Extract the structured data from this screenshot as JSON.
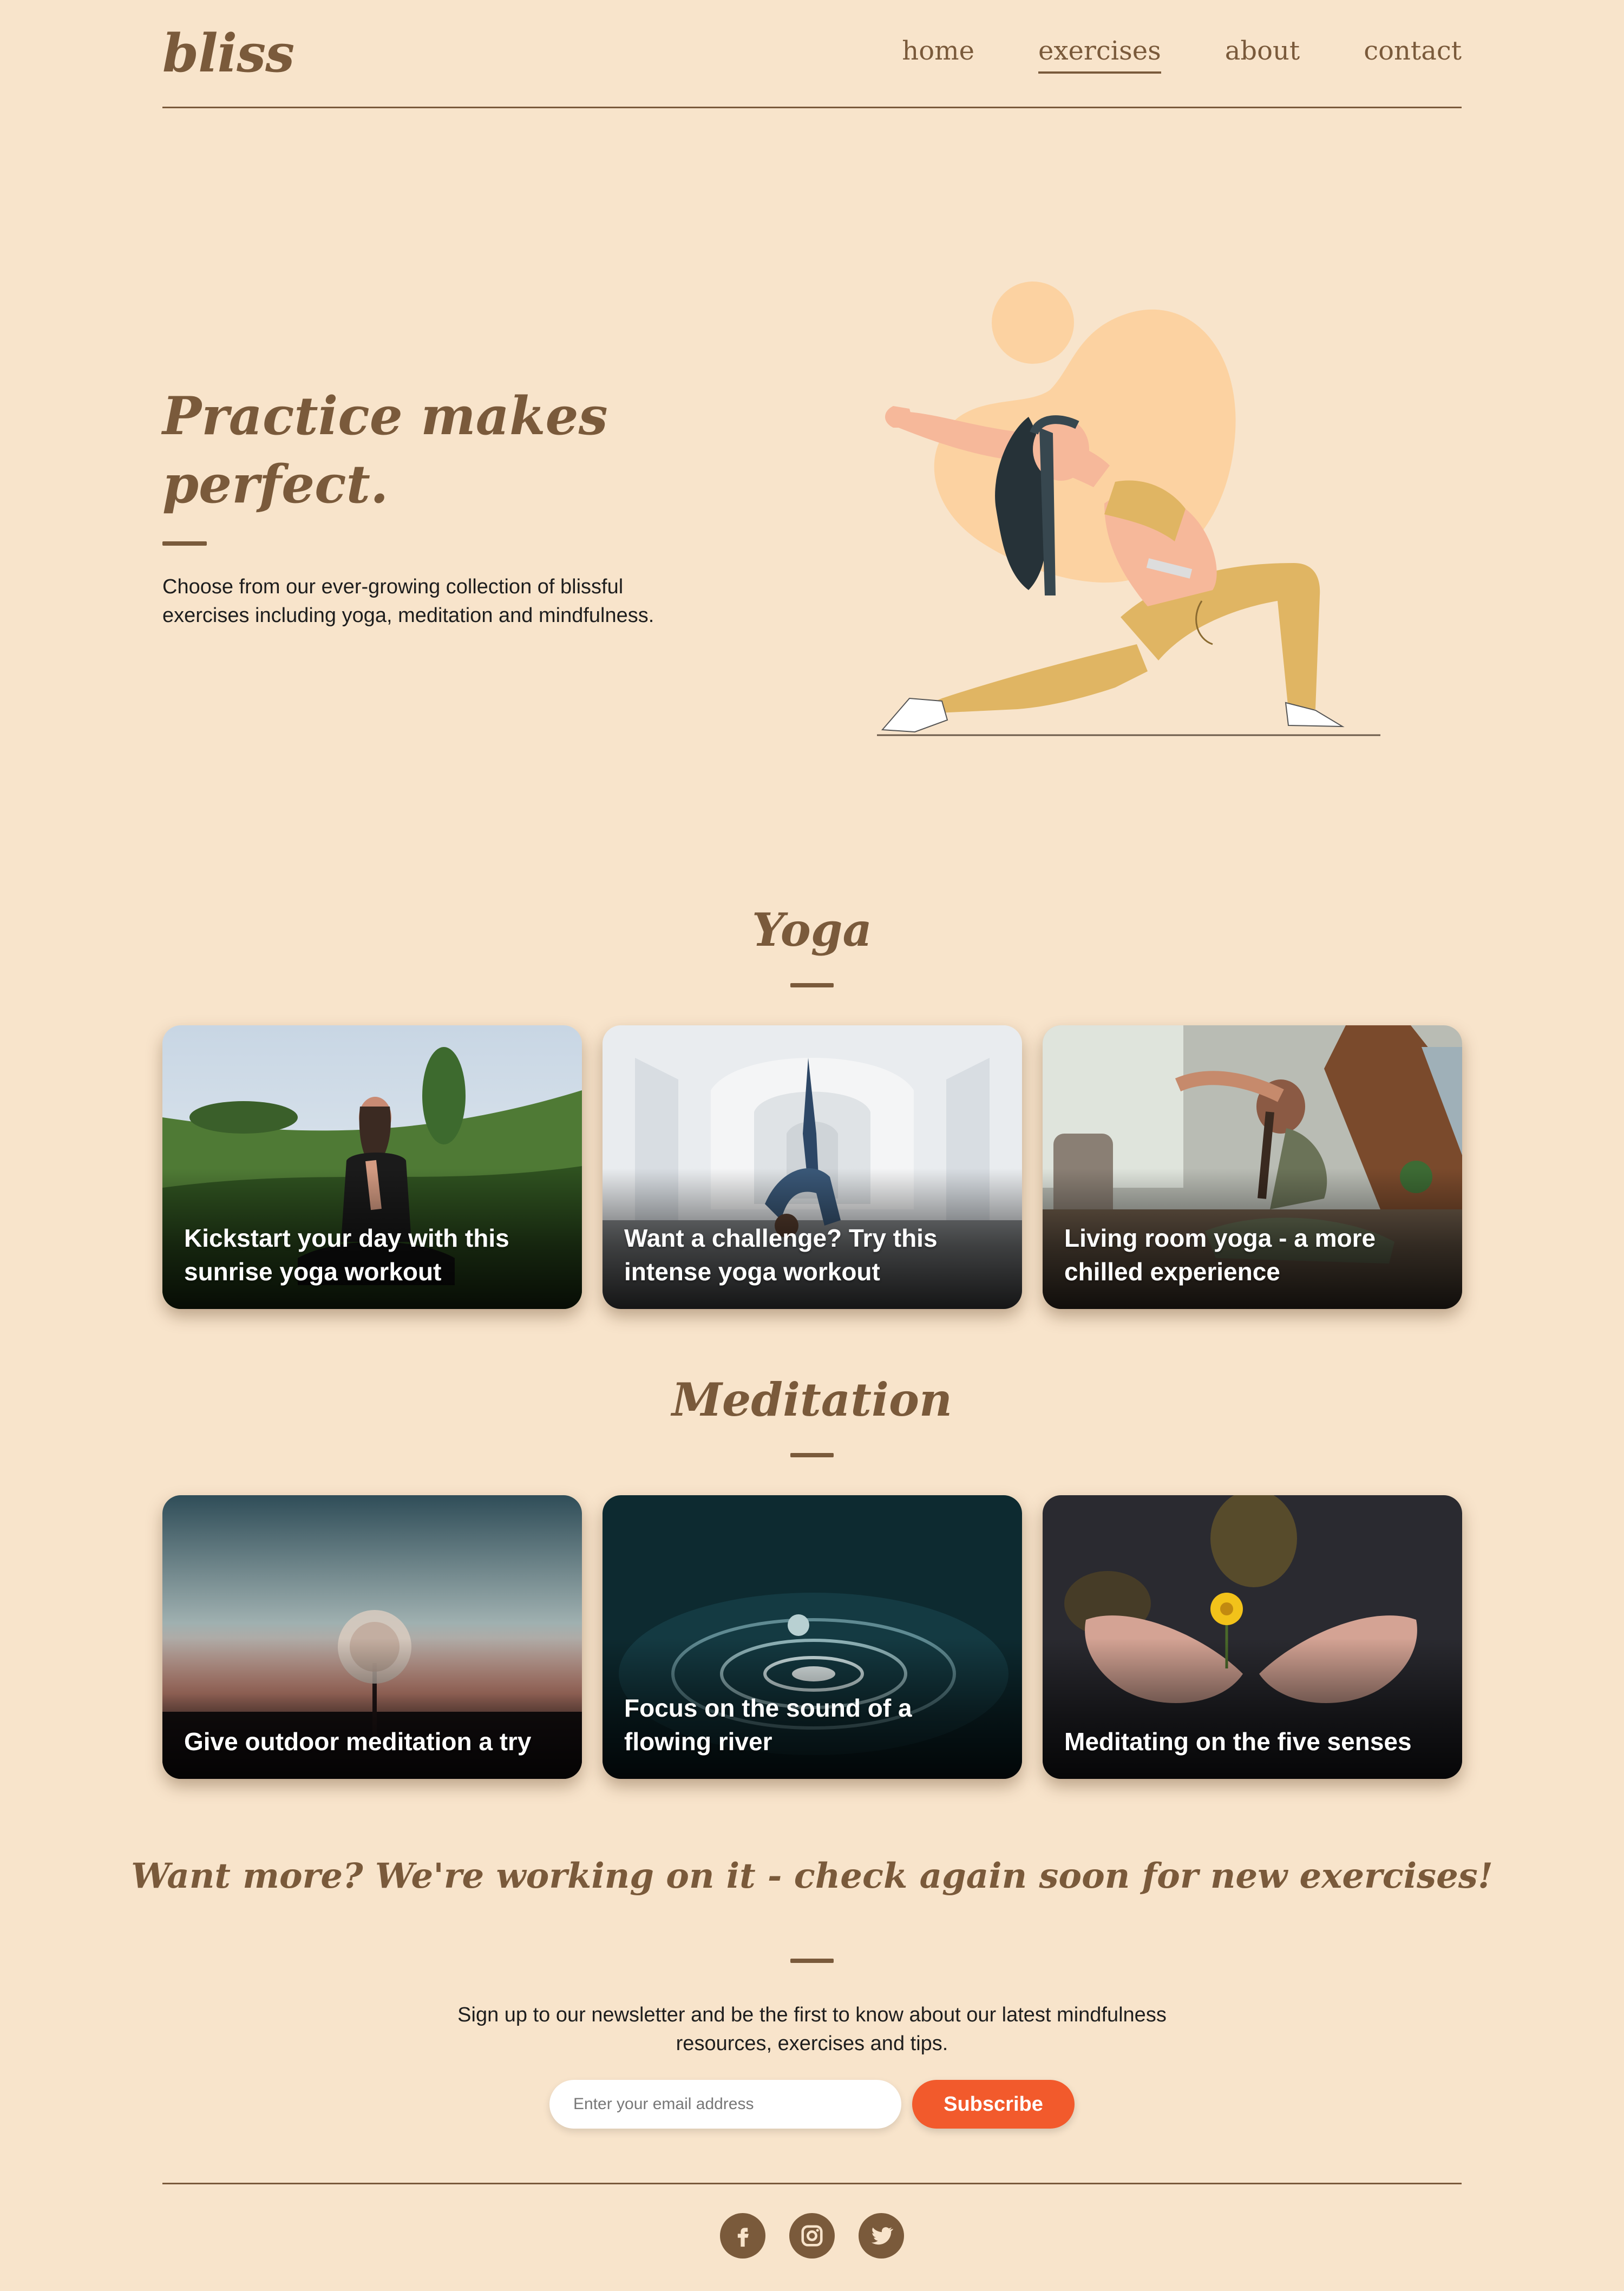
{
  "header": {
    "logo": "bliss",
    "nav": [
      "home",
      "exercises",
      "about",
      "contact"
    ],
    "active_nav": "exercises"
  },
  "hero": {
    "title_line1": "Practice makes",
    "title_line2": "perfect.",
    "text": "Choose from our ever-growing collection of blissful exercises including yoga, meditation and mindfulness."
  },
  "yoga": {
    "title": "Yoga",
    "cards": [
      {
        "caption": "Kickstart your day with this sunrise yoga workout"
      },
      {
        "caption": "Want a challenge? Try this intense yoga workout"
      },
      {
        "caption": "Living room yoga - a more chilled experience"
      }
    ]
  },
  "meditation": {
    "title": "Meditation",
    "cards": [
      {
        "caption": "Give outdoor meditation a try"
      },
      {
        "caption": "Focus on the sound of a flowing river"
      },
      {
        "caption": "Meditating on the five senses"
      }
    ]
  },
  "newsletter": {
    "heading": "Want more? We're working on it - check again soon for new exercises!",
    "text": "Sign up to our newsletter and be the first to know about our latest mindfulness resources, exercises and tips.",
    "email_placeholder": "Enter your email address",
    "button": "Subscribe"
  },
  "footer": {
    "social_icons": [
      "facebook-icon",
      "instagram-icon",
      "twitter-icon"
    ]
  },
  "colors": {
    "background": "#f8e4cb",
    "brand_brown": "#7a5a3b",
    "accent_orange": "#f25a2c"
  }
}
